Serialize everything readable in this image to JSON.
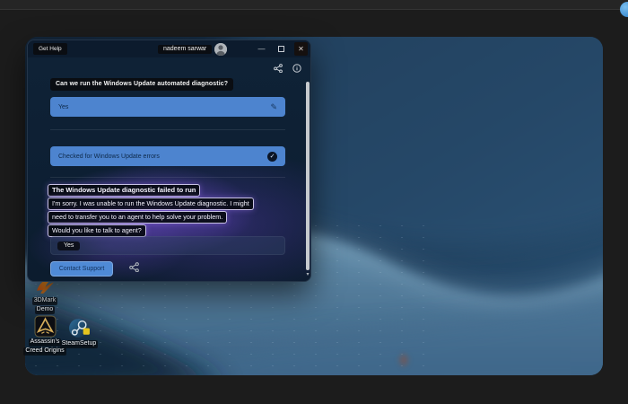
{
  "window": {
    "title": "Get Help",
    "user": "nadeem sarwar",
    "chat": {
      "question": "Can we run the Windows Update automated diagnostic?",
      "answer": "Yes",
      "status": "Checked for Windows Update errors",
      "result_title": "The Windows Update diagnostic failed to run",
      "result_line1": "I'm sorry.  I was unable to run the Windows Update diagnostic. I might",
      "result_line2": "need to transfer you to an agent to help solve your problem.",
      "result_question": "Would you like to talk to agent?",
      "option_yes": "Yes",
      "contact_button": "Contact Support"
    }
  },
  "desktop": {
    "icons": [
      {
        "name": "3DMark Demo",
        "line1": "3DMark",
        "line2": "Demo"
      },
      {
        "name": "Assassin's Creed Origins",
        "line1": "Assassin's",
        "line2": "Creed Origins"
      },
      {
        "name": "SteamSetup",
        "line1": "SteamSetup",
        "line2": ""
      }
    ]
  },
  "icons": {
    "pencil": "✎",
    "check": "✓",
    "minimize": "—",
    "close": "✕",
    "scroll_down": "▾"
  },
  "colors": {
    "accent_blue": "#4d84cf",
    "contact_blue": "#4f8ad6",
    "highlight_glow": "#8a58f5",
    "wallpaper_navy": "#16293d",
    "titlebar": "#0c1b2d"
  }
}
